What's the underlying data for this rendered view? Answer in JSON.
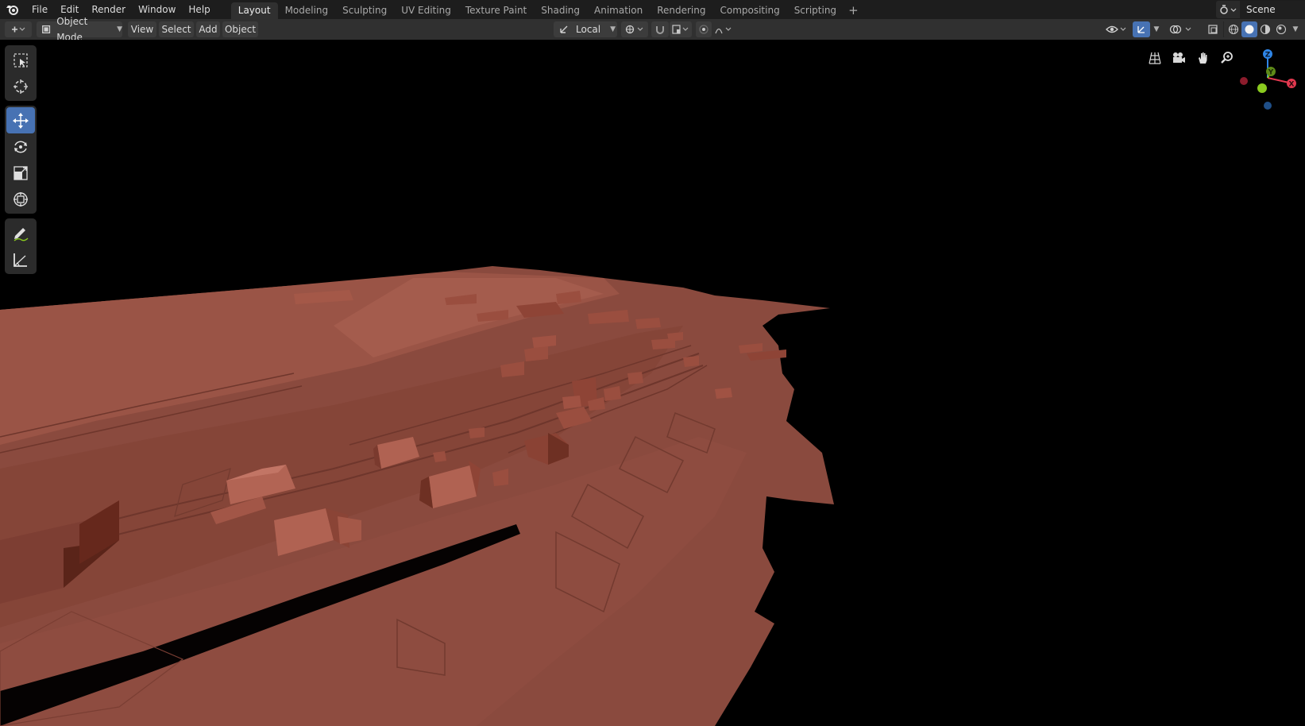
{
  "topbar": {
    "menu": [
      "File",
      "Edit",
      "Render",
      "Window",
      "Help"
    ],
    "workspaces": [
      "Layout",
      "Modeling",
      "Sculpting",
      "UV Editing",
      "Texture Paint",
      "Shading",
      "Animation",
      "Rendering",
      "Compositing",
      "Scripting"
    ],
    "active_workspace": "Layout",
    "add_workspace": "+",
    "scene_name": "Scene"
  },
  "header": {
    "mode": "Object Mode",
    "view": "View",
    "select": "Select",
    "add": "Add",
    "object": "Object",
    "orientation": "Local"
  },
  "toolbar": {
    "tools": [
      "select-box",
      "cursor",
      "move",
      "rotate",
      "scale",
      "transform",
      "annotate",
      "measure"
    ],
    "active_tool": "move"
  },
  "gizmo": {
    "axes": {
      "x": "X",
      "y": "Y",
      "z": "Z"
    },
    "colors": {
      "x": "#e2384f",
      "y": "#8acb1f",
      "z": "#2f86e8",
      "x_neg": "#8c1c2c",
      "z_neg": "#1f4f88"
    }
  },
  "colors": {
    "terrain": "#8a4a3e",
    "accent": "#4772b3"
  }
}
